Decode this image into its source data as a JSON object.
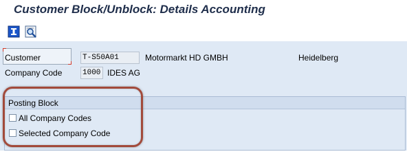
{
  "title": "Customer Block/Unblock: Details Accounting",
  "toolbar": {
    "buttons": [
      {
        "icon": "info-icon",
        "label": ""
      },
      {
        "icon": "where-used-list-icon",
        "label": ""
      }
    ]
  },
  "header_fields": {
    "customer": {
      "label": "Customer",
      "value": "T-S50A01",
      "name": "Motormarkt HD GMBH",
      "city": "Heidelberg"
    },
    "company_code": {
      "label": "Company Code",
      "value": "1000",
      "name": "IDES AG"
    }
  },
  "posting_block": {
    "title": "Posting Block",
    "options": [
      {
        "label": "All Company Codes",
        "checked": false
      },
      {
        "label": "Selected Company Code",
        "checked": false
      }
    ]
  },
  "colors": {
    "title_text": "#1f2e4b",
    "background": "#dfe9f5",
    "highlight": "#a24a3b"
  }
}
